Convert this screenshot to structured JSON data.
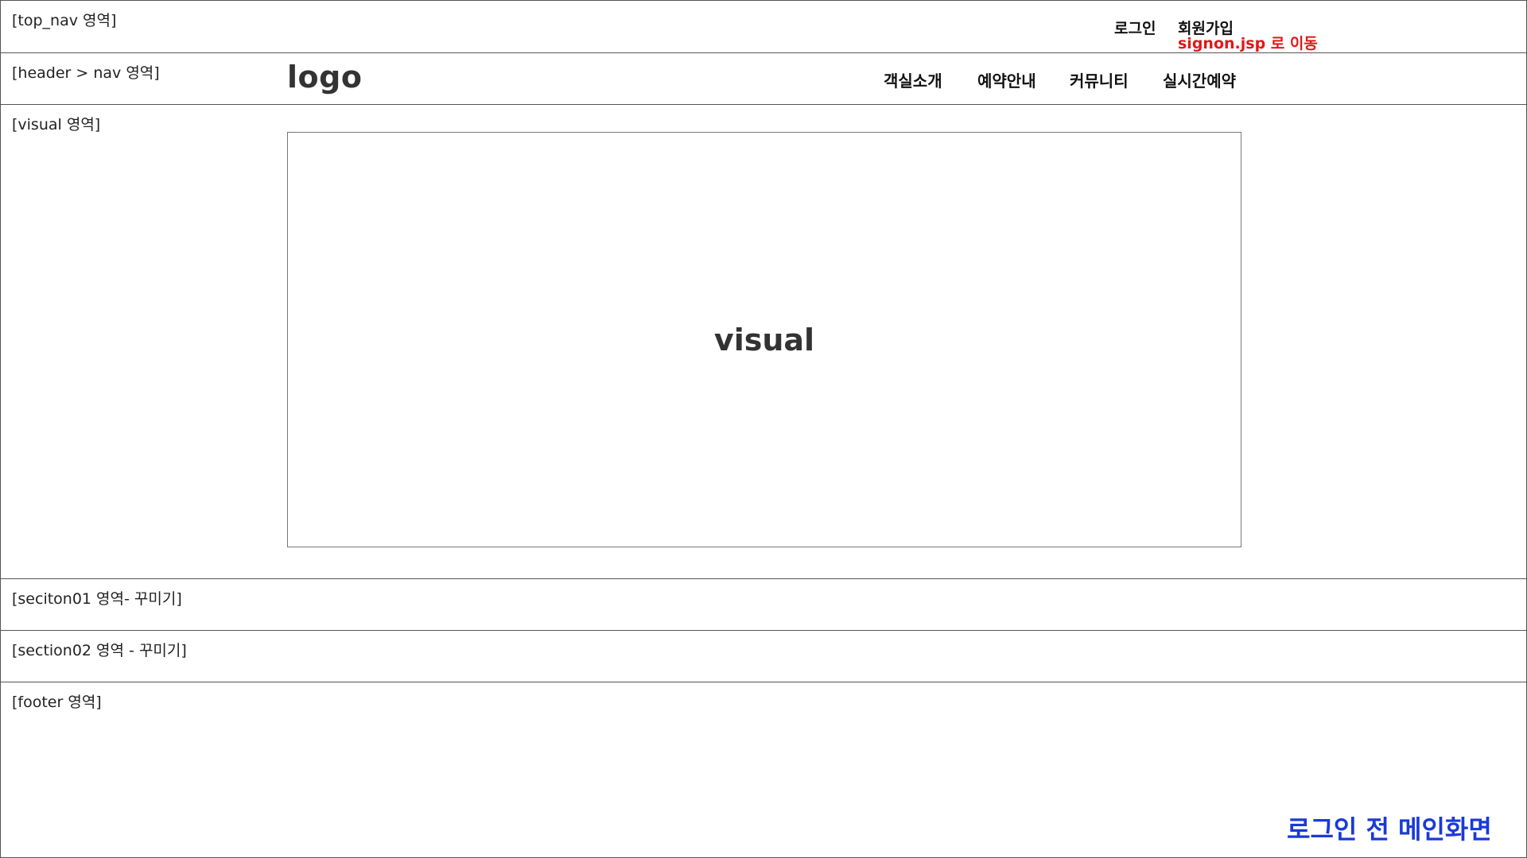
{
  "top_nav": {
    "area_label": "[top_nav 영역]",
    "login_label": "로그인",
    "join_label": "회원가입",
    "join_note": "signon.jsp 로 이동"
  },
  "header": {
    "area_label": "[header > nav 영역]",
    "logo_text": "logo",
    "menu": [
      "객실소개",
      "예약안내",
      "커뮤니티",
      "실시간예약"
    ]
  },
  "visual": {
    "area_label": "[visual 영역]",
    "placeholder_text": "visual"
  },
  "section01": {
    "area_label": "[seciton01 영역- 꾸미기]"
  },
  "section02": {
    "area_label": "[section02 영역 - 꾸미기]"
  },
  "footer": {
    "area_label": "[footer 영역]",
    "page_caption": "로그인 전 메인화면"
  },
  "colors": {
    "note_red": "#e01818",
    "caption_blue": "#1a3ad8",
    "border": "#555555"
  }
}
